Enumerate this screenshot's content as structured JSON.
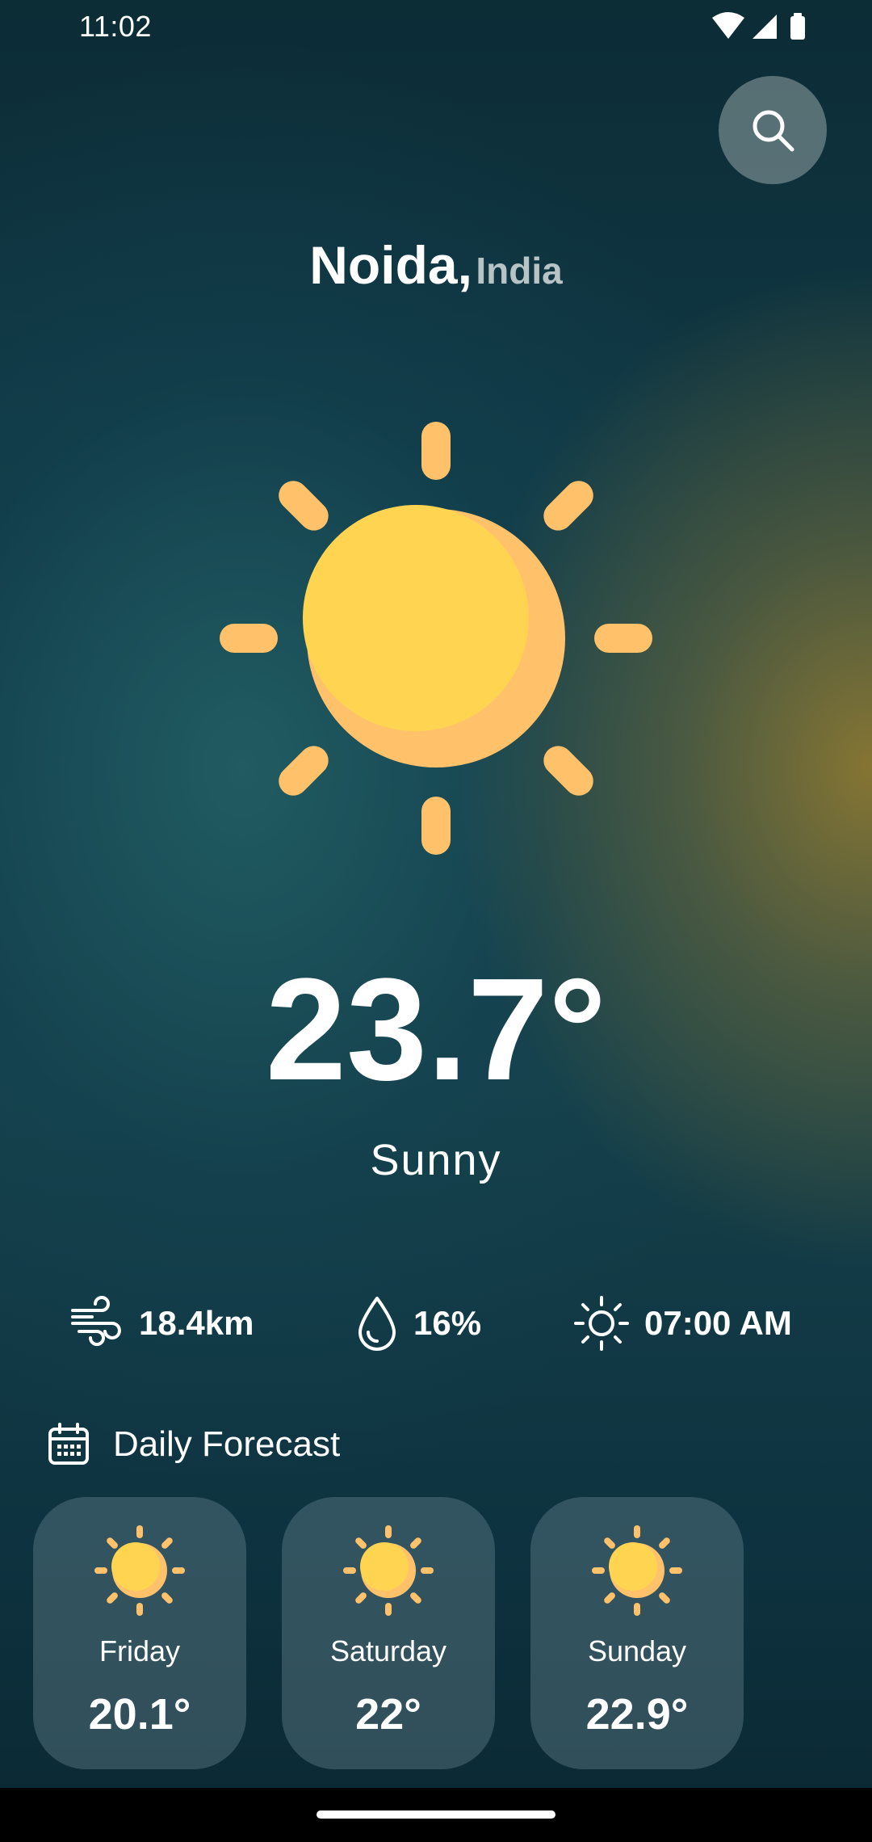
{
  "status_bar": {
    "time": "11:02"
  },
  "search": {
    "icon": "search-icon"
  },
  "location": {
    "city": "Noida,",
    "country": "India"
  },
  "current": {
    "icon": "sun-icon",
    "temperature": "23.7°",
    "condition": "Sunny"
  },
  "stats": {
    "wind": {
      "icon": "wind-icon",
      "value": "18.4km"
    },
    "humidity": {
      "icon": "droplet-icon",
      "value": "16%"
    },
    "sunrise": {
      "icon": "sun-outline-icon",
      "value": "07:00 AM"
    }
  },
  "forecast": {
    "title": "Daily Forecast",
    "icon": "calendar-icon",
    "days": [
      {
        "day": "Friday",
        "temp": "20.1°",
        "icon": "sun-icon"
      },
      {
        "day": "Saturday",
        "temp": "22°",
        "icon": "sun-icon"
      },
      {
        "day": "Sunday",
        "temp": "22.9°",
        "icon": "sun-icon"
      }
    ]
  },
  "colors": {
    "sun_face": "#FFD451",
    "sun_shade": "#FFC26B",
    "sun_rays": "#FFC26B"
  }
}
